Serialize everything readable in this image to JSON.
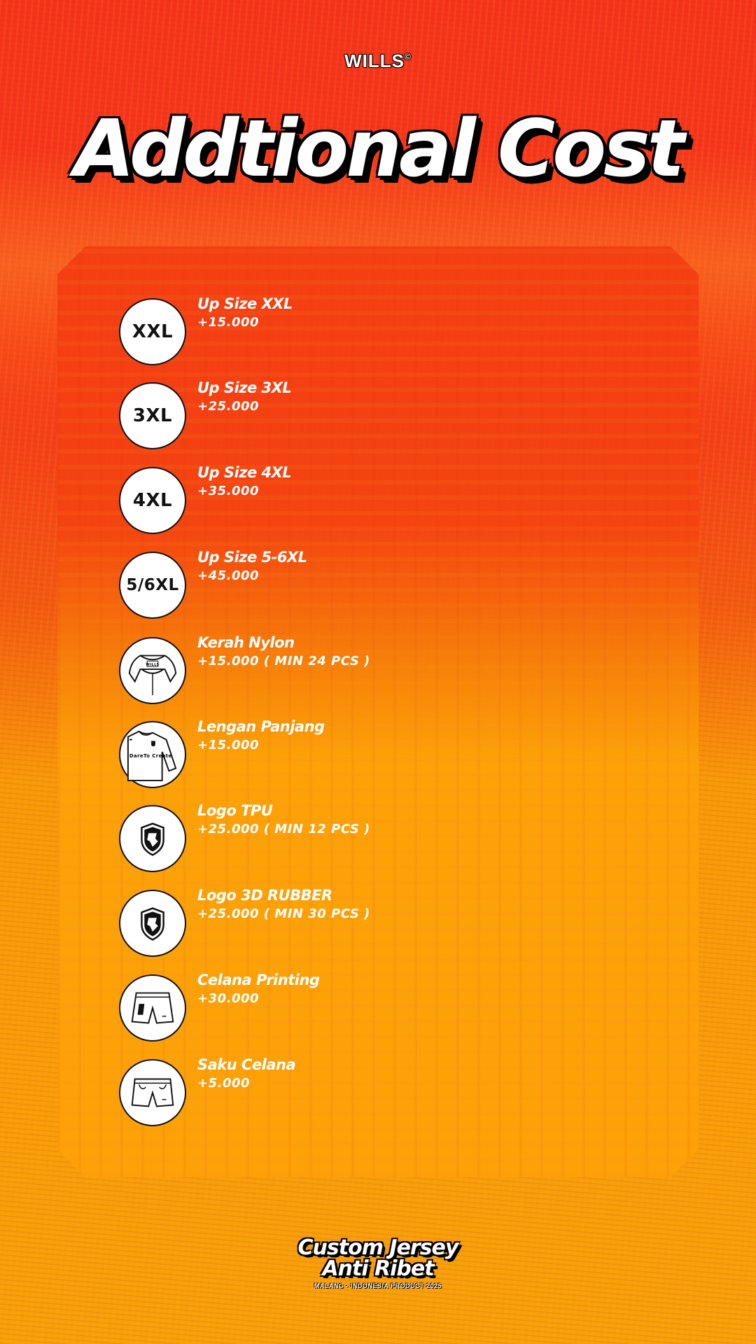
{
  "brand": {
    "name": "WILLS",
    "mark": "©"
  },
  "headline": "Addtional Cost",
  "items": [
    {
      "badge": "XXL",
      "icon": "",
      "label": "Up Size XXL",
      "price": "+15.000"
    },
    {
      "badge": "3XL",
      "icon": "",
      "label": "Up Size 3XL",
      "price": "+25.000"
    },
    {
      "badge": "4XL",
      "icon": "",
      "label": "Up Size 4XL",
      "price": "+35.000"
    },
    {
      "badge": "5/6XL",
      "icon": "",
      "label": "Up Size 5-6XL",
      "price": "+45.000"
    },
    {
      "badge": "",
      "icon": "collar-icon",
      "label": "Kerah Nylon",
      "price": "+15.000 ( MIN 24 PCS )",
      "collar_tag": "WILLS"
    },
    {
      "badge": "",
      "icon": "long-sleeve-jersey-icon",
      "label": "Lengan Panjang",
      "price": "+15.000",
      "shirt_text": "DareTo Create"
    },
    {
      "badge": "",
      "icon": "shield-logo-icon",
      "label": "Logo TPU",
      "price": "+25.000 ( MIN 12 PCS )"
    },
    {
      "badge": "",
      "icon": "shield-logo-icon",
      "label": "Logo 3D RUBBER",
      "price": "+25.000 ( MIN 30 PCS )"
    },
    {
      "badge": "",
      "icon": "shorts-icon",
      "label": "Celana Printing",
      "price": "+30.000"
    },
    {
      "badge": "",
      "icon": "shorts-pocket-icon",
      "label": "Saku Celana",
      "price": "+5.000"
    }
  ],
  "footer": {
    "line1": "Custom Jersey",
    "line2": "Anti Ribet",
    "tagline": "MALANG - INDONESIA PRODUCT 2025"
  },
  "colors": {
    "top": "#f5331c",
    "bottom": "#f7a10a",
    "text": "#ffffff",
    "outline": "#000000"
  }
}
